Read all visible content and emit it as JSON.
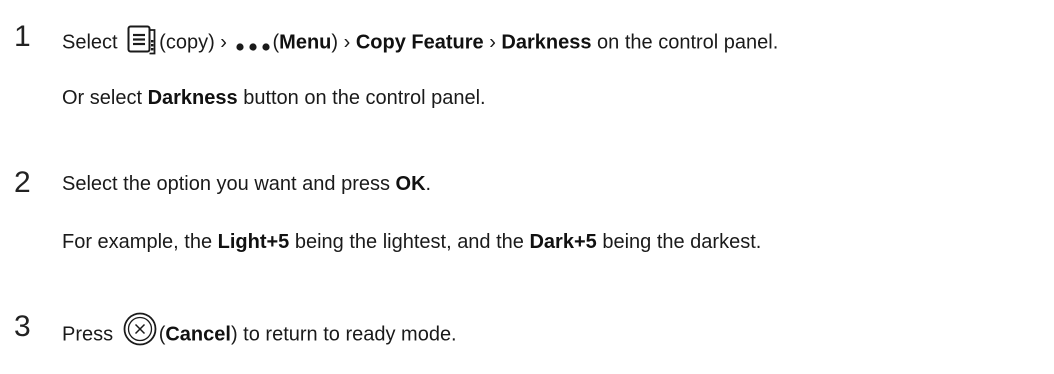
{
  "steps": [
    {
      "number": "1",
      "line1": {
        "pre": "Select",
        "copy_label": "(copy) › ",
        "menu_open": "(",
        "menu_label": "Menu",
        "menu_close": ") › ",
        "feature_label": "Copy Feature",
        "sep": " › ",
        "darkness_label": "Darkness",
        "post": " on the control panel."
      },
      "line2": {
        "pre": "Or select ",
        "bold": "Darkness",
        "post": " button on the control panel."
      }
    },
    {
      "number": "2",
      "line1": {
        "pre": "Select the option you want and press ",
        "bold": "OK",
        "post": "."
      },
      "line2": {
        "pre": "For example, the ",
        "bold1": "Light+5",
        "mid": " being the lightest, and the ",
        "bold2": "Dark+5",
        "post": " being the darkest."
      }
    },
    {
      "number": "3",
      "line1": {
        "pre": "Press",
        "paren_open": "(",
        "bold": "Cancel",
        "post": ") to return to ready mode."
      }
    }
  ],
  "icons": {
    "copy": "copy-icon",
    "menu": "more-dots-icon",
    "cancel": "cancel-icon"
  }
}
